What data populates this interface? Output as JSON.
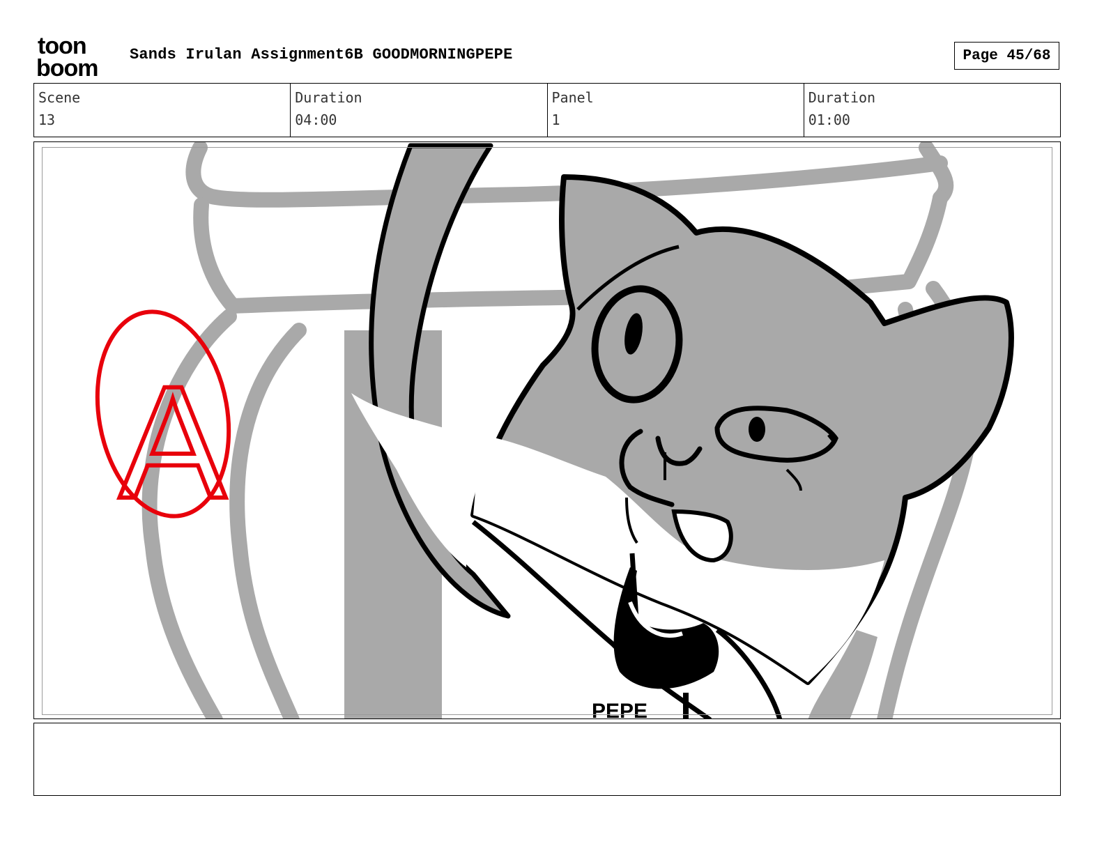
{
  "logo": {
    "line1": "toon",
    "line2": "boom"
  },
  "header": {
    "title": "Sands Irulan Assignment6B GOODMORNINGPEPE",
    "page_label": "Page",
    "page_value": "45/68"
  },
  "info": {
    "scene_label": "Scene",
    "scene_value": "13",
    "scene_duration_label": "Duration",
    "scene_duration_value": "04:00",
    "panel_label": "Panel",
    "panel_value": "1",
    "panel_duration_label": "Duration",
    "panel_duration_value": "01:00"
  },
  "panel": {
    "annotation_mark": "A",
    "shirt_text": "PEPE"
  },
  "colors": {
    "gray_fill": "#a9a9a9",
    "annotation_red": "#e8000b",
    "ink": "#000000"
  }
}
